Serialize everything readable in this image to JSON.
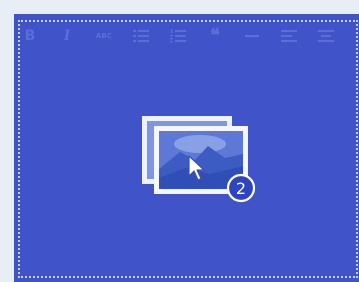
{
  "editor": {
    "toolbar": {
      "bold_label": "B",
      "italic_label": "I",
      "strikethrough_label": "ABC",
      "blockquote_label": "❝"
    },
    "drop_zone": {
      "file_count": "2",
      "icons": [
        "images-icon",
        "cursor-icon"
      ]
    },
    "colors": {
      "background": "#4053c8",
      "toolbar_icon": "#5c6dd8",
      "dotted_border": "#c8d0f6"
    }
  }
}
